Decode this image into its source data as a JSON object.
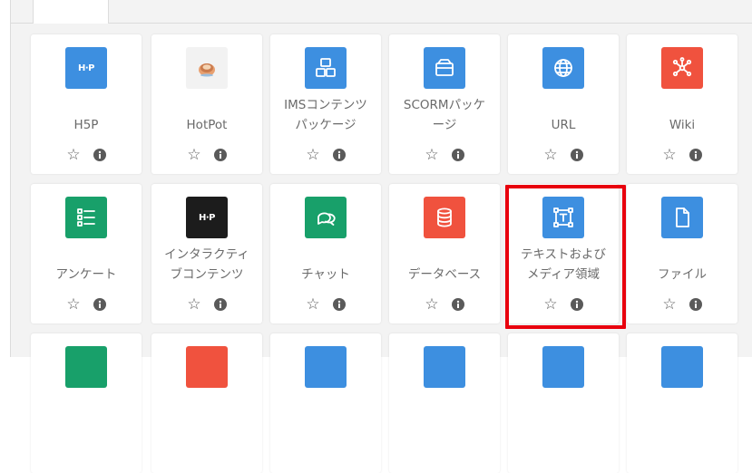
{
  "colors": {
    "blue": "#3d8fe0",
    "green": "#18a06a",
    "red": "#f0523e",
    "black": "#1c1c1c",
    "highlight": "#e8000d"
  },
  "tiles": [
    {
      "id": "h5p",
      "label": "H5P",
      "icon": "h5p-icon",
      "color": "#3d8fe0",
      "glyph": "H·P"
    },
    {
      "id": "hotpot",
      "label": "HotPot",
      "icon": "hotpot-icon",
      "color": "#f2f2f2"
    },
    {
      "id": "ims",
      "label": "IMSコンテンツ\nパッケージ",
      "icon": "package-icon",
      "color": "#3d8fe0"
    },
    {
      "id": "scorm",
      "label": "SCORMパッケ\nージ",
      "icon": "box-icon",
      "color": "#3d8fe0"
    },
    {
      "id": "url",
      "label": "URL",
      "icon": "globe-icon",
      "color": "#3d8fe0"
    },
    {
      "id": "wiki",
      "label": "Wiki",
      "icon": "wiki-icon",
      "color": "#f0523e"
    },
    {
      "id": "questionnaire",
      "label": "アンケート",
      "icon": "list-icon",
      "color": "#18a06a"
    },
    {
      "id": "interactive",
      "label": "インタラクティ\nブコンテンツ",
      "icon": "h5p-dark-icon",
      "color": "#1c1c1c",
      "glyph": "H·P"
    },
    {
      "id": "chat",
      "label": "チャット",
      "icon": "chat-icon",
      "color": "#18a06a"
    },
    {
      "id": "database",
      "label": "データベース",
      "icon": "database-icon",
      "color": "#f0523e"
    },
    {
      "id": "textmedia",
      "label": "テキストおよび\nメディア領域",
      "icon": "text-media-icon",
      "color": "#3d8fe0"
    },
    {
      "id": "file",
      "label": "ファイル",
      "icon": "file-icon",
      "color": "#3d8fe0"
    }
  ],
  "partial_row_colors": [
    "#18a06a",
    "#f0523e",
    "#3d8fe0",
    "#3d8fe0",
    "#3d8fe0",
    "#3d8fe0"
  ],
  "star_glyph": "☆",
  "highlighted_tile": "textmedia"
}
